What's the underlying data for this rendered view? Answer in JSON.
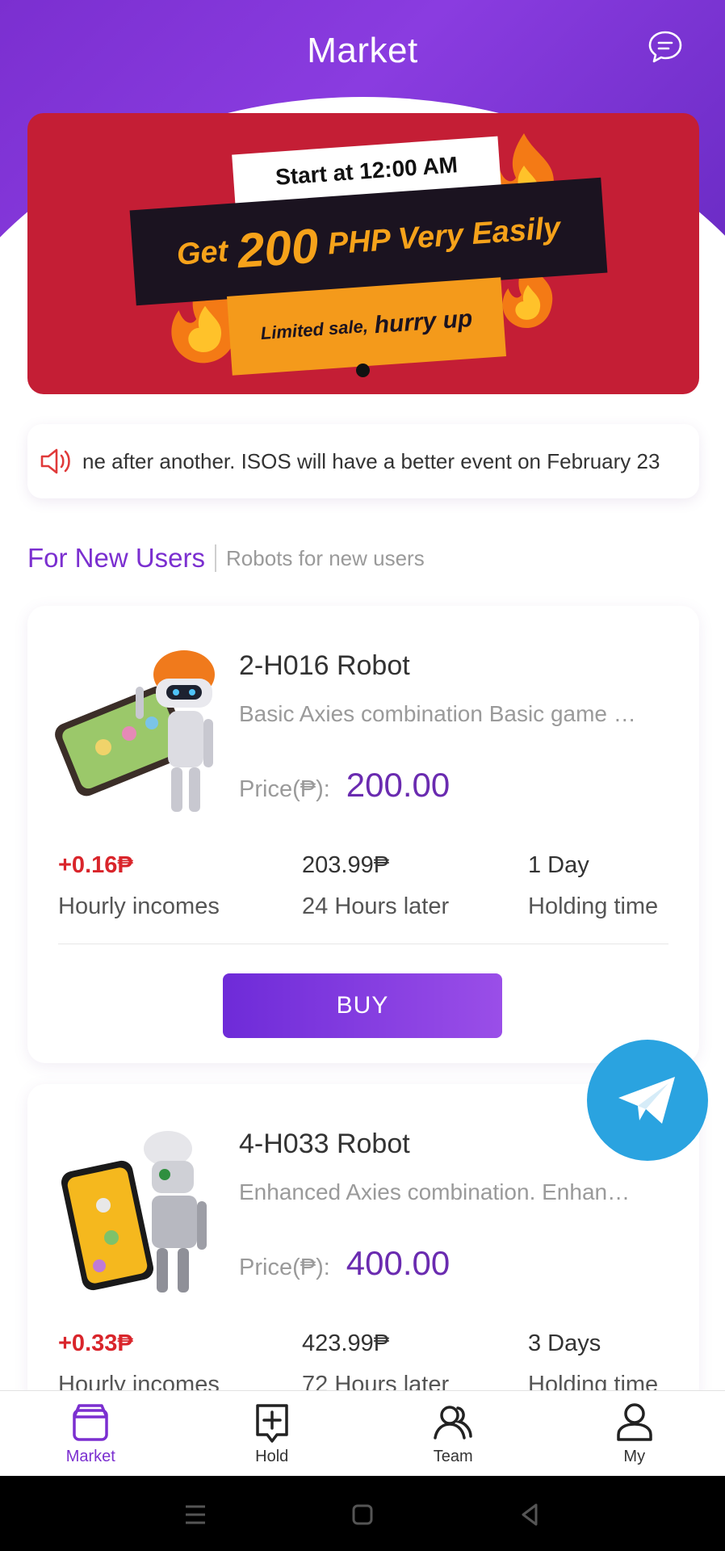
{
  "header": {
    "title": "Market",
    "chat_icon": "chat-bubble-icon"
  },
  "banner": {
    "line1": "Start at 12:00 AM",
    "line2_pre": "Get",
    "line2_big": "200",
    "line2_post": "PHP Very Easily",
    "line3_pre": "Limited sale,",
    "line3_post": "hurry up",
    "bg_color": "#c41e35"
  },
  "notice": {
    "icon": "speaker-icon",
    "text": "ne after another. ISOS will have a better event on February 23"
  },
  "section": {
    "title": "For New Users",
    "subtitle": "Robots for new users"
  },
  "products": [
    {
      "name": "2-H016 Robot",
      "desc": "Basic Axies combination Basic game …",
      "price_label": "Price(₱):",
      "price": "200.00",
      "hourly": "+0.16₱",
      "hourly_label": "Hourly incomes",
      "later": "203.99₱",
      "later_label": "24 Hours later",
      "hold": "1 Day",
      "hold_label": "Holding time",
      "buy": "BUY"
    },
    {
      "name": "4-H033 Robot",
      "desc": "Enhanced Axies combination. Enhan…",
      "price_label": "Price(₱):",
      "price": "400.00",
      "hourly": "+0.33₱",
      "hourly_label": "Hourly incomes",
      "later": "423.99₱",
      "later_label": "72 Hours later",
      "hold": "3 Days",
      "hold_label": "Holding time"
    }
  ],
  "tabs": [
    {
      "label": "Market",
      "icon": "market-box-icon",
      "active": true
    },
    {
      "label": "Hold",
      "icon": "plus-square-icon",
      "active": false
    },
    {
      "label": "Team",
      "icon": "team-icon",
      "active": false
    },
    {
      "label": "My",
      "icon": "user-icon",
      "active": false
    }
  ],
  "colors": {
    "accent": "#7b2fd0",
    "income_red": "#d9252b",
    "telegram": "#2aa3e0"
  }
}
